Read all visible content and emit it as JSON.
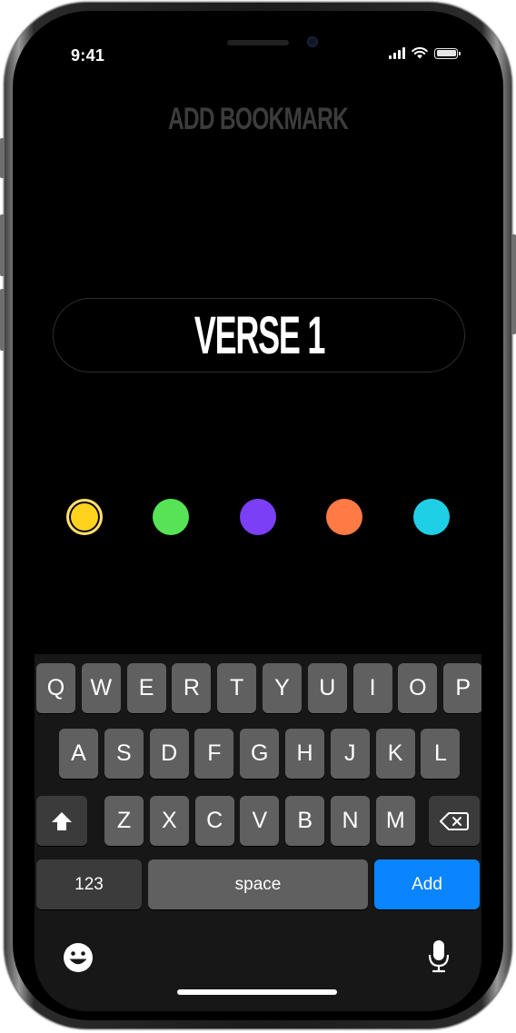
{
  "status_bar": {
    "time": "9:41"
  },
  "header": {
    "title": "ADD BOOKMARK"
  },
  "bookmark": {
    "name": "VERSE 1"
  },
  "colors": {
    "options": [
      {
        "name": "yellow",
        "hex": "#FFD21E",
        "selected": true
      },
      {
        "name": "green",
        "hex": "#57E356",
        "selected": false
      },
      {
        "name": "purple",
        "hex": "#7B3FF5",
        "selected": false
      },
      {
        "name": "orange",
        "hex": "#FF7A45",
        "selected": false
      },
      {
        "name": "cyan",
        "hex": "#1FCFE6",
        "selected": false
      }
    ]
  },
  "keyboard": {
    "row1": [
      "Q",
      "W",
      "E",
      "R",
      "T",
      "Y",
      "U",
      "I",
      "O",
      "P"
    ],
    "row2": [
      "A",
      "S",
      "D",
      "F",
      "G",
      "H",
      "J",
      "K",
      "L"
    ],
    "row3": [
      "Z",
      "X",
      "C",
      "V",
      "B",
      "N",
      "M"
    ],
    "numbers_label": "123",
    "space_label": "space",
    "return_label": "Add",
    "return_color": "#0A84FF",
    "icons": [
      "shift-icon",
      "backspace-icon",
      "emoji-icon",
      "microphone-icon"
    ]
  }
}
